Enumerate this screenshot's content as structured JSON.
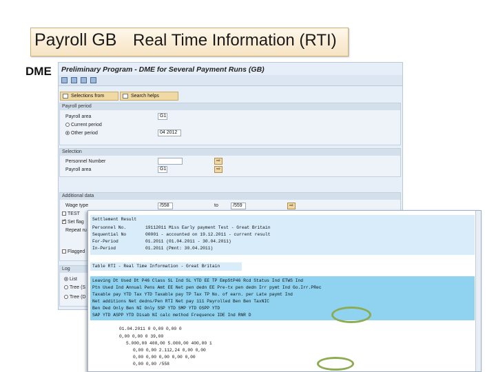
{
  "slide": {
    "title_main": "Payroll GB",
    "title_sub": "Real Time Information (RTI)",
    "dme_label": "DME"
  },
  "window1": {
    "title": "Preliminary Program - DME for Several Payment Runs (GB)",
    "buttons": {
      "selections_from": "Selections from",
      "search_helps": "Search helps"
    },
    "payroll_period": {
      "header": "Payroll period",
      "payroll_area_label": "Payroll area",
      "payroll_area_value": "G1",
      "current_period": "Current period",
      "other_period": "Other period",
      "other_period_value": "04 2012"
    },
    "selection": {
      "header": "Selection",
      "personnel_number": "Personnel Number",
      "payroll_area_label": "Payroll area",
      "payroll_area_value": "G1"
    },
    "additional": {
      "header": "Additional data",
      "wage_type": "Wage type",
      "wage_from": "/558",
      "to_label": "to",
      "wage_to": "/559",
      "test": "TEST",
      "set_flag": "Set flag",
      "repeat_run": "Repeat ru",
      "flagged": "Flagged"
    },
    "log": {
      "header": "Log",
      "list": "List",
      "tree_s": "Tree (S",
      "tree_d": "Tree (D"
    }
  },
  "window2": {
    "settlement_result": {
      "heading": "Settlement Result",
      "rows": [
        [
          "Personnel No.",
          "19112011 Miss Early payment Test - Great Britain"
        ],
        [
          "Sequential No",
          "00001 - accounted on 19.12.2011 - current result"
        ],
        [
          "For-Period",
          "01.2011 (01.04.2011 - 30.04.2011)"
        ],
        [
          "In-Period",
          "01.2011 (Pmnt: 30.04.2011)"
        ]
      ]
    },
    "table_title": "Table RTI - Real Time Information - Great Britain",
    "header_lines": [
      "Leaving Dt  Used Dt    P46 Class  SL Ind  SL YTD                EE TP                    EmpStP46  Rcd Status Ind  ETWS Ind",
      "Ptn Used Ind  Annual Pens Amt     EE Net pen dedn      EE Pre-tx pen dedn       Irr pymt Ind  Go.Irr.PRec",
      "Taxable pay YTD    Tax YTD          Taxable pay TP       Tax TP                    No. of earn. per  Late paymt Ind",
      "Net additions      Net dedns/Pen    RTI Net pay          111 Payrolled Ben         Ben TaxNIC",
      "Ben Ded Only       Ben NI Only      SSP YTD              SMP YTD                   OSPP YTD",
      "SAP YTD            ASPP YTD         Disab NI calc method  Frequence  IDE  Ind  RNR  D"
    ],
    "value_lines": [
      "01.04.2011  0                                0,00          0,00  0",
      "                                             0,00                       0,00  0           39,00",
      "5.000,00          400,00         5.000,00         400,00        1",
      "0,00              0,00           2.112,24           0,00                        0,00",
      "0,00              0,00              0,00            0,00                        0,00",
      "0,00              0,00           /558"
    ]
  }
}
